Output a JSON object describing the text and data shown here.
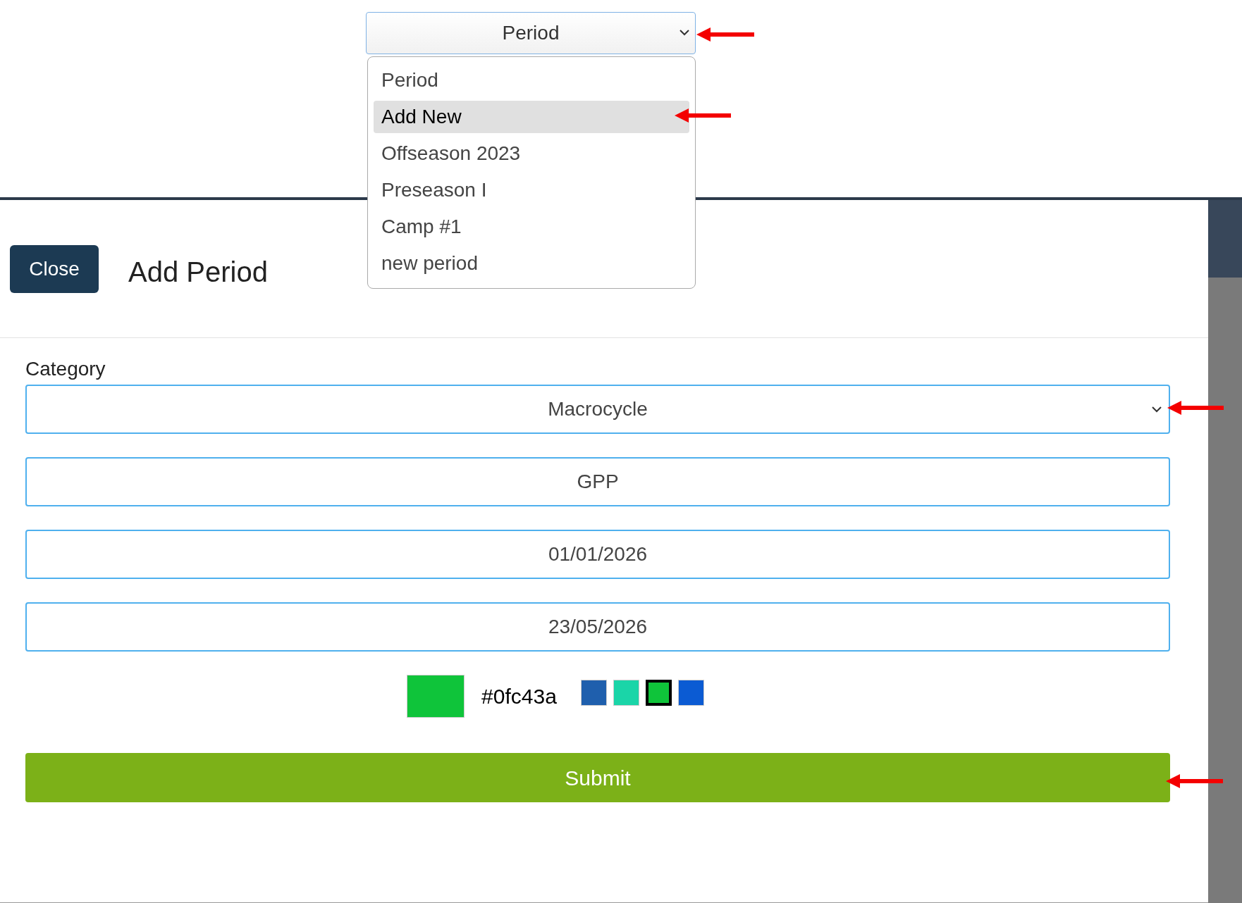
{
  "period_select": {
    "value": "Period",
    "expanded": true,
    "options": [
      {
        "label": "Period",
        "highlighted": false
      },
      {
        "label": "Add New",
        "highlighted": true
      },
      {
        "label": "Offseason 2023",
        "highlighted": false
      },
      {
        "label": "Preseason I",
        "highlighted": false
      },
      {
        "label": "Camp #1",
        "highlighted": false
      },
      {
        "label": "new period",
        "highlighted": false
      }
    ]
  },
  "modal": {
    "close_button": "Close",
    "title": "Add Period",
    "category_label": "Category",
    "category_select": "Macrocycle",
    "fields": [
      {
        "value": "GPP"
      },
      {
        "value": "01/01/2026"
      },
      {
        "value": "23/05/2026"
      }
    ],
    "color": {
      "value": "#0fc43a",
      "swatches": [
        {
          "color": "#1f5fad",
          "selected": false
        },
        {
          "color": "#1ad5a8",
          "selected": false
        },
        {
          "color": "#0fc43a",
          "selected": true
        },
        {
          "color": "#0b5bd3",
          "selected": false
        }
      ]
    },
    "submit": "Submit"
  }
}
